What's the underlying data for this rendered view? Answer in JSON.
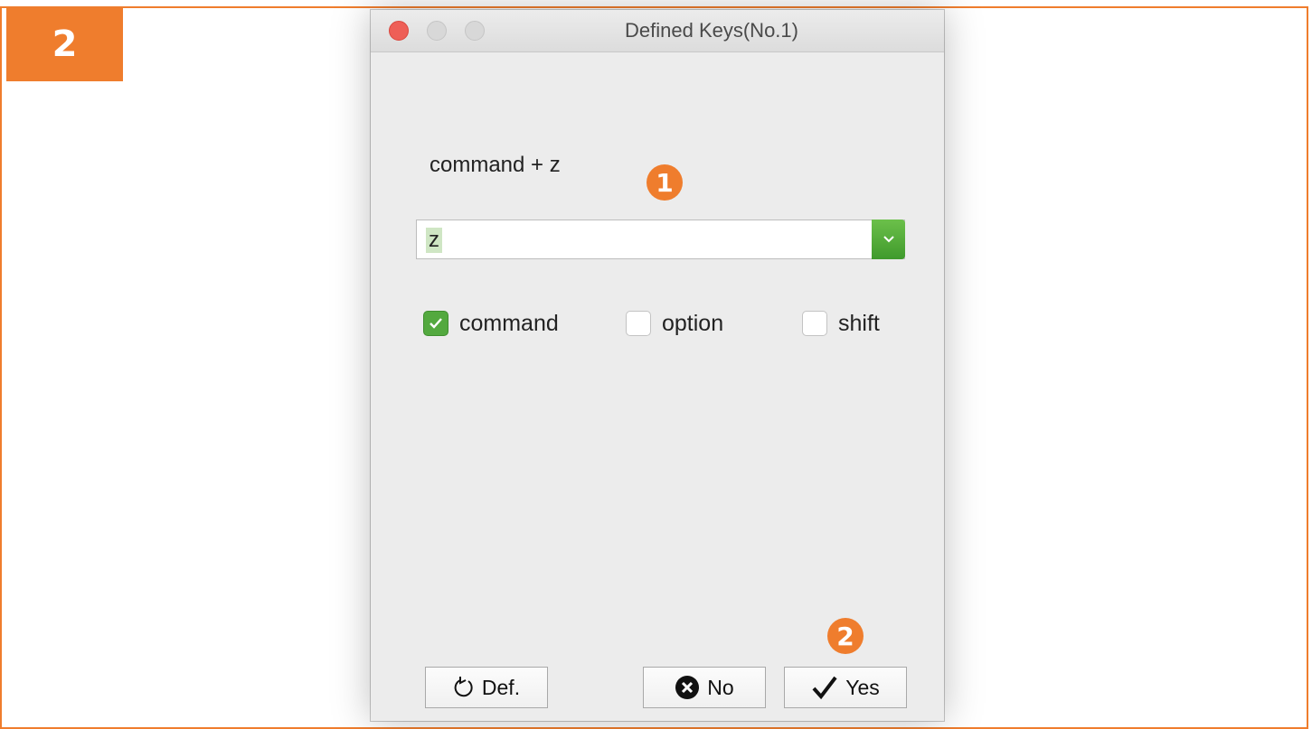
{
  "step": {
    "number": "2"
  },
  "window": {
    "title": "Defined Keys(No.1)"
  },
  "shortcut": {
    "combination": "command + z",
    "key_value": "z"
  },
  "modifiers": [
    {
      "label": "command",
      "checked": true
    },
    {
      "label": "option",
      "checked": false
    },
    {
      "label": "shift",
      "checked": false
    }
  ],
  "buttons": {
    "default_label": "Def.",
    "no_label": "No",
    "yes_label": "Yes"
  },
  "callouts": {
    "first": "1",
    "second": "2"
  },
  "colors": {
    "accent_orange": "#ef7d2d",
    "checkbox_green": "#53a93f",
    "close_red": "#ee5f57"
  }
}
